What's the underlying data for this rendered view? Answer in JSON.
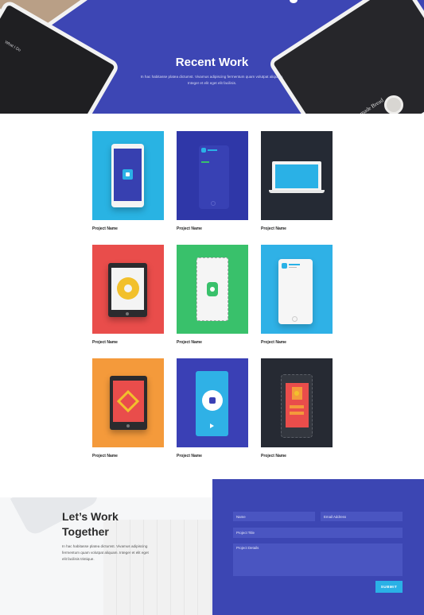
{
  "hero": {
    "title": "Recent Work",
    "description": "In hac habitasse platea dictumst. Vivamus adipiscing fermentum quam volutpat aliquam. Integer et elit eget elit facilisis.",
    "left_tablet_label": "What I Do",
    "right_tablet_label": "Homemade Bread"
  },
  "projects": [
    {
      "name": "Project Name",
      "bg": "#29b3e3"
    },
    {
      "name": "Project Name",
      "bg": "#2f37a8"
    },
    {
      "name": "Project Name",
      "bg": "#252a34"
    },
    {
      "name": "Project Name",
      "bg": "#e94d4b"
    },
    {
      "name": "Project Name",
      "bg": "#39c16b"
    },
    {
      "name": "Project Name",
      "bg": "#2fb1e6"
    },
    {
      "name": "Project Name",
      "bg": "#f49a3b"
    },
    {
      "name": "Project Name",
      "bg": "#3a40b5"
    },
    {
      "name": "Project Name",
      "bg": "#262a33"
    }
  ],
  "contact": {
    "title_line1": "Let’s Work",
    "title_line2": "Together",
    "description": "In hac habitasse platea dictumst. Vivamus adipiscing fermentum quam volutpat aliquam. Integer et elit eget elit facilisis tristique.",
    "name_placeholder": "Name",
    "email_placeholder": "Email Address",
    "project_title_placeholder": "Project Title",
    "project_details_placeholder": "Project Details",
    "submit_label": "SUBMIT"
  },
  "colors": {
    "brand_blue": "#3d46b4",
    "accent_cyan": "#2ab1e6"
  }
}
